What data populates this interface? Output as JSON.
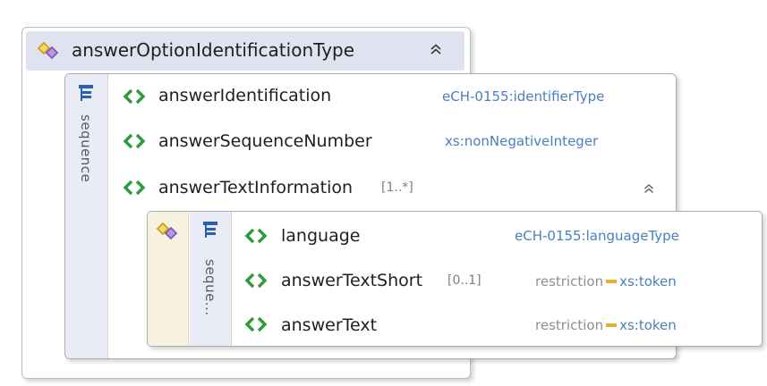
{
  "outer": {
    "title": "answerOptionIdentificationType",
    "collapse_glyph": "≈"
  },
  "sequence": {
    "label": "sequence",
    "elements": [
      {
        "name": "answerIdentification",
        "cardinality": "",
        "type": "eCH-0155:identifierType"
      },
      {
        "name": "answerSequenceNumber",
        "cardinality": "",
        "type": "xs:nonNegativeInteger"
      },
      {
        "name": "answerTextInformation",
        "cardinality": "[1..*]",
        "type": ""
      }
    ]
  },
  "inner": {
    "sequence_label": "seque...",
    "elements": [
      {
        "name": "language",
        "cardinality": "",
        "type": "eCH-0155:languageType"
      },
      {
        "name": "answerTextShort",
        "cardinality": "[0..1]",
        "restriction": "restriction",
        "type": "xs:token"
      },
      {
        "name": "answerText",
        "cardinality": "",
        "restriction": "restriction",
        "type": "xs:token"
      }
    ]
  },
  "icons": {
    "complex_type": "complex-type-icon",
    "sequence": "sequence-icon",
    "element": "element-icon",
    "collapse": "collapse-icon"
  },
  "colors": {
    "header_bg": "#dfe3ef",
    "type_link": "#4a7fc0",
    "element_icon": "#2e9a3a",
    "restriction_bar": "#e2b02a"
  }
}
